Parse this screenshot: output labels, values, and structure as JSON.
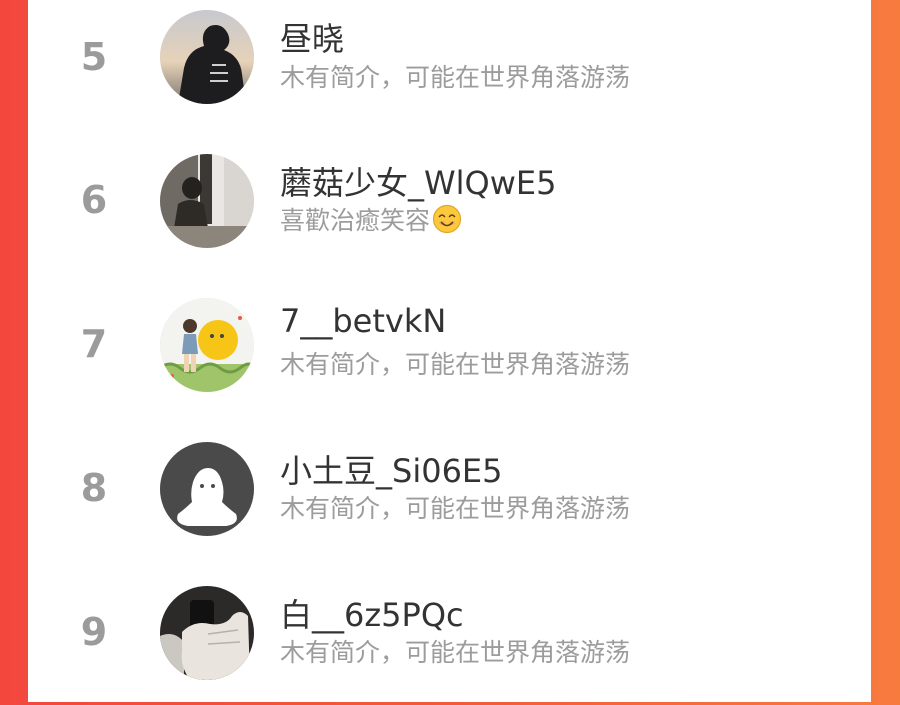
{
  "colors": {
    "background_left": "#f3473d",
    "background_right": "#f87b3e",
    "card": "#ffffff",
    "rank": "#9b9b9b",
    "name": "#333333",
    "bio": "#9c9c9c"
  },
  "users": [
    {
      "rank": "5",
      "name": "昼晓",
      "bio": "木有简介，可能在世界角落游荡",
      "avatar": "person-in-black-hoodie-photo"
    },
    {
      "rank": "6",
      "name": "蘑菇少女_WlQwE5",
      "bio": "喜歡治癒笑容",
      "bio_icon": "smiling-face-emoji",
      "avatar": "person-sitting-indoors-photo"
    },
    {
      "rank": "7",
      "name": "7__betvkN",
      "bio": "木有简介，可能在世界角落游荡",
      "avatar": "child-with-yellow-ball-illustration"
    },
    {
      "rank": "8",
      "name": "小土豆_Si06E5",
      "bio": "木有简介，可能在世界角落游荡",
      "avatar": "default-ghost-avatar"
    },
    {
      "rank": "9",
      "name": "白__6z5PQc",
      "bio": "木有简介，可能在世界角落游荡",
      "avatar": "hand-holding-phone-photo"
    }
  ]
}
